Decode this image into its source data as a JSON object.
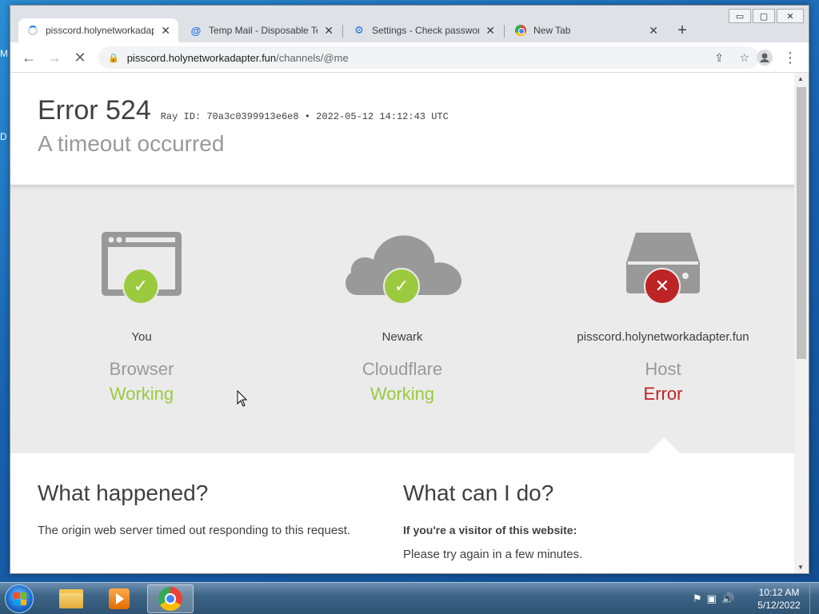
{
  "desktop": {
    "edge_glyph_1": "M",
    "edge_glyph_2": "D"
  },
  "window": {
    "minimize": "▭",
    "maximize": "▢",
    "close": "✕"
  },
  "tabs": [
    {
      "label": "pisscord.holynetworkadapter.fun",
      "icon": "loading-spinner",
      "active": true
    },
    {
      "label": "Temp Mail - Disposable Temporary Email",
      "icon": "at-icon"
    },
    {
      "label": "Settings - Check passwords",
      "icon": "gear-icon"
    },
    {
      "label": "New Tab",
      "icon": "chrome-icon"
    }
  ],
  "toolbar": {
    "back": "←",
    "forward": "→",
    "stop": "✕",
    "url_host": "pisscord.holynetworkadapter.fun",
    "url_path": "/channels/@me",
    "share": "⇪",
    "star": "☆",
    "menu": "⋮"
  },
  "error": {
    "code": "Error 524",
    "ray": "Ray ID: 70a3c0399913e6e8 • 2022-05-12 14:12:43 UTC",
    "subtitle": "A timeout occurred"
  },
  "nodes": [
    {
      "location": "You",
      "role": "Browser",
      "status": "Working",
      "ok": true
    },
    {
      "location": "Newark",
      "role": "Cloudflare",
      "status": "Working",
      "ok": true
    },
    {
      "location": "pisscord.holynetworkadapter.fun",
      "role": "Host",
      "status": "Error",
      "ok": false
    }
  ],
  "what_happened": {
    "title": "What happened?",
    "body": "The origin web server timed out responding to this request."
  },
  "what_can_i_do": {
    "title": "What can I do?",
    "visitor_heading": "If you're a visitor of this website:",
    "visitor_body": "Please try again in a few minutes."
  },
  "taskbar": {
    "clock_time": "10:12 AM",
    "clock_date": "5/12/2022"
  },
  "colors": {
    "ok": "#9bca3e",
    "error": "#bd2426",
    "accent": "#1a73e8"
  }
}
